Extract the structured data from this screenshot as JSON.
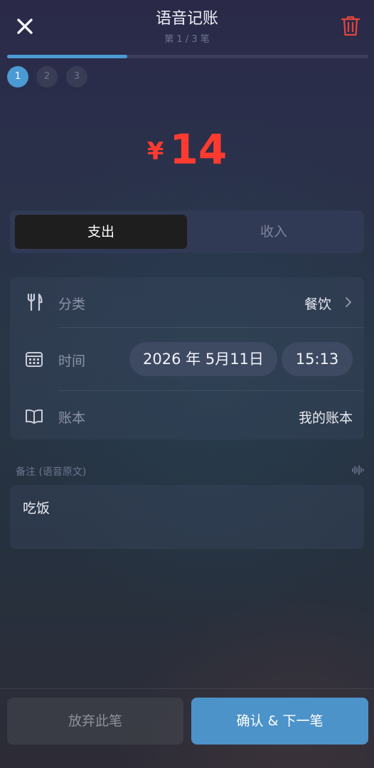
{
  "header": {
    "title": "语音记账",
    "subtitle": "第 1 / 3 笔",
    "close_icon": "close-icon",
    "trash_icon": "trash-icon",
    "trash_color": "#e5453c"
  },
  "progress": {
    "current": 1,
    "total": 3,
    "fraction": 0.333,
    "steps": [
      "1",
      "2",
      "3"
    ],
    "accent": "#4b9ad4"
  },
  "amount": {
    "currency": "¥",
    "value": "14",
    "color": "#ff3b30"
  },
  "type_segment": {
    "expense": "支出",
    "income": "收入",
    "selected": "expense"
  },
  "details": {
    "category": {
      "icon": "fork-knife-icon",
      "label": "分类",
      "value": "餐饮"
    },
    "time": {
      "icon": "calendar-icon",
      "label": "时间",
      "date": "2026 年 5月11日",
      "clock": "15:13"
    },
    "ledger": {
      "icon": "book-icon",
      "label": "账本",
      "value": "我的账本"
    }
  },
  "note": {
    "label": "备注 (语音原文)",
    "icon": "waveform-icon",
    "text": "吃饭"
  },
  "footer": {
    "discard": "放弃此笔",
    "confirm": "确认 & 下一笔"
  }
}
